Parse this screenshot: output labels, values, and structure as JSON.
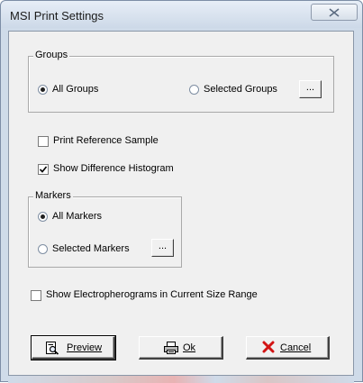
{
  "window": {
    "title": "MSI Print Settings"
  },
  "groups": {
    "legend": "Groups",
    "all_label": "All Groups",
    "selected_label": "Selected Groups",
    "selected_option": "All Groups",
    "dots_label": "..."
  },
  "options": {
    "print_reference_sample": {
      "label": "Print Reference Sample",
      "checked": false
    },
    "show_difference_histogram": {
      "label": "Show Difference Histogram",
      "checked": true
    }
  },
  "markers": {
    "legend": "Markers",
    "all_label": "All Markers",
    "selected_label": "Selected Markers",
    "selected_option": "All Markers",
    "dots_label": "..."
  },
  "electropherograms": {
    "label": "Show Electropherograms in Current Size Range",
    "checked": false
  },
  "buttons": {
    "preview": {
      "label": "Preview",
      "icon": "print-preview-icon"
    },
    "ok": {
      "label": "Ok",
      "icon": "printer-icon"
    },
    "cancel": {
      "label": "Cancel",
      "icon": "red-x-icon",
      "icon_color": "#d21414"
    }
  }
}
